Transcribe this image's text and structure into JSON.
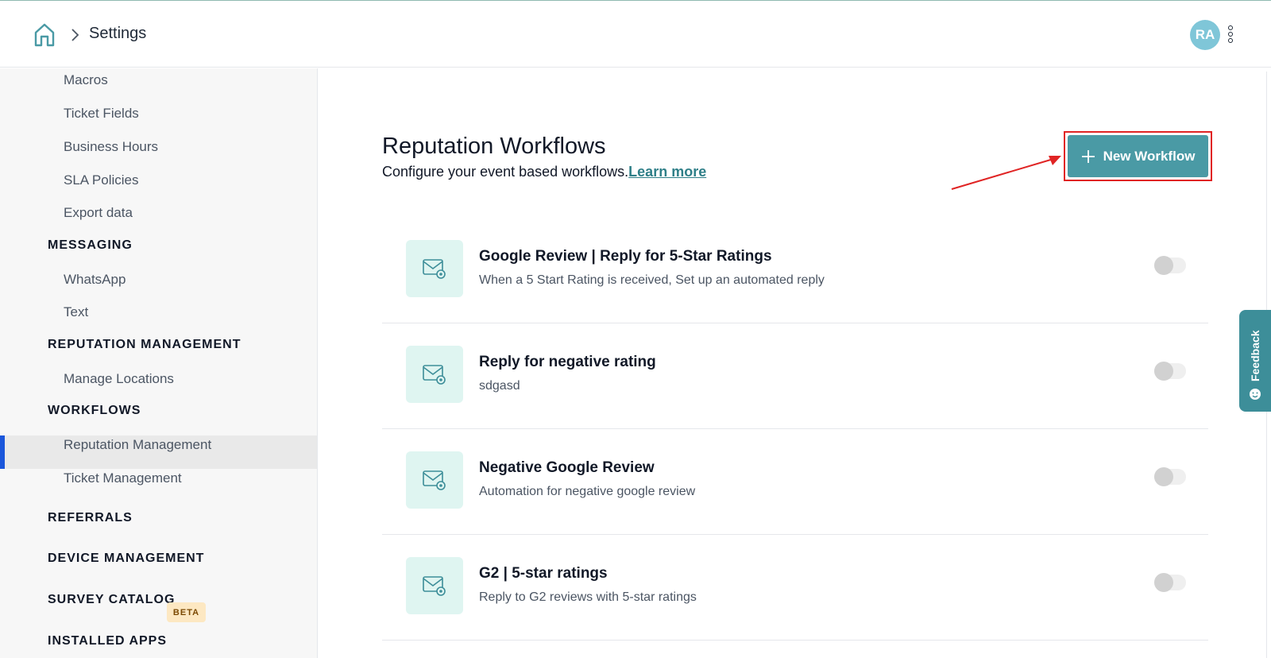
{
  "header": {
    "breadcrumb": "Settings",
    "avatar_initials": "RA"
  },
  "sidebar": {
    "items": [
      {
        "label": "Macros",
        "type": "item"
      },
      {
        "label": "Ticket Fields",
        "type": "item"
      },
      {
        "label": "Business Hours",
        "type": "item"
      },
      {
        "label": "SLA Policies",
        "type": "item"
      },
      {
        "label": "Export data",
        "type": "item"
      },
      {
        "label": "MESSAGING",
        "type": "heading"
      },
      {
        "label": "WhatsApp",
        "type": "item"
      },
      {
        "label": "Text",
        "type": "item"
      },
      {
        "label": "REPUTATION MANAGEMENT",
        "type": "heading"
      },
      {
        "label": "Manage Locations",
        "type": "item"
      },
      {
        "label": "WORKFLOWS",
        "type": "heading"
      },
      {
        "label": "Reputation Management",
        "type": "item",
        "active": true
      },
      {
        "label": "Ticket Management",
        "type": "item"
      },
      {
        "label": "REFERRALS",
        "type": "heading"
      },
      {
        "label": "DEVICE MANAGEMENT",
        "type": "heading"
      },
      {
        "label": "SURVEY CATALOG",
        "type": "heading"
      },
      {
        "label": "INSTALLED APPS",
        "type": "heading"
      }
    ],
    "beta_badge": "BETA"
  },
  "main": {
    "title": "Reputation Workflows",
    "subtitle": "Configure your event based workflows.",
    "learn_more": "Learn more",
    "new_workflow_label": "New Workflow",
    "workflows": [
      {
        "title": "Google Review | Reply for 5-Star Ratings",
        "description": "When a 5 Start Rating is received, Set up an automated reply",
        "enabled": false
      },
      {
        "title": "Reply for negative rating",
        "description": "sdgasd",
        "enabled": false
      },
      {
        "title": "Negative Google Review",
        "description": "Automation for negative google review",
        "enabled": false
      },
      {
        "title": "G2 | 5-star ratings",
        "description": "Reply to G2 reviews with 5-star ratings",
        "enabled": false
      }
    ]
  },
  "feedback": {
    "label": "Feedback"
  },
  "colors": {
    "accent": "#4a9aa5",
    "active_bar": "#1a56db",
    "highlight": "#e02424",
    "icon_bg": "#dff5f1"
  }
}
